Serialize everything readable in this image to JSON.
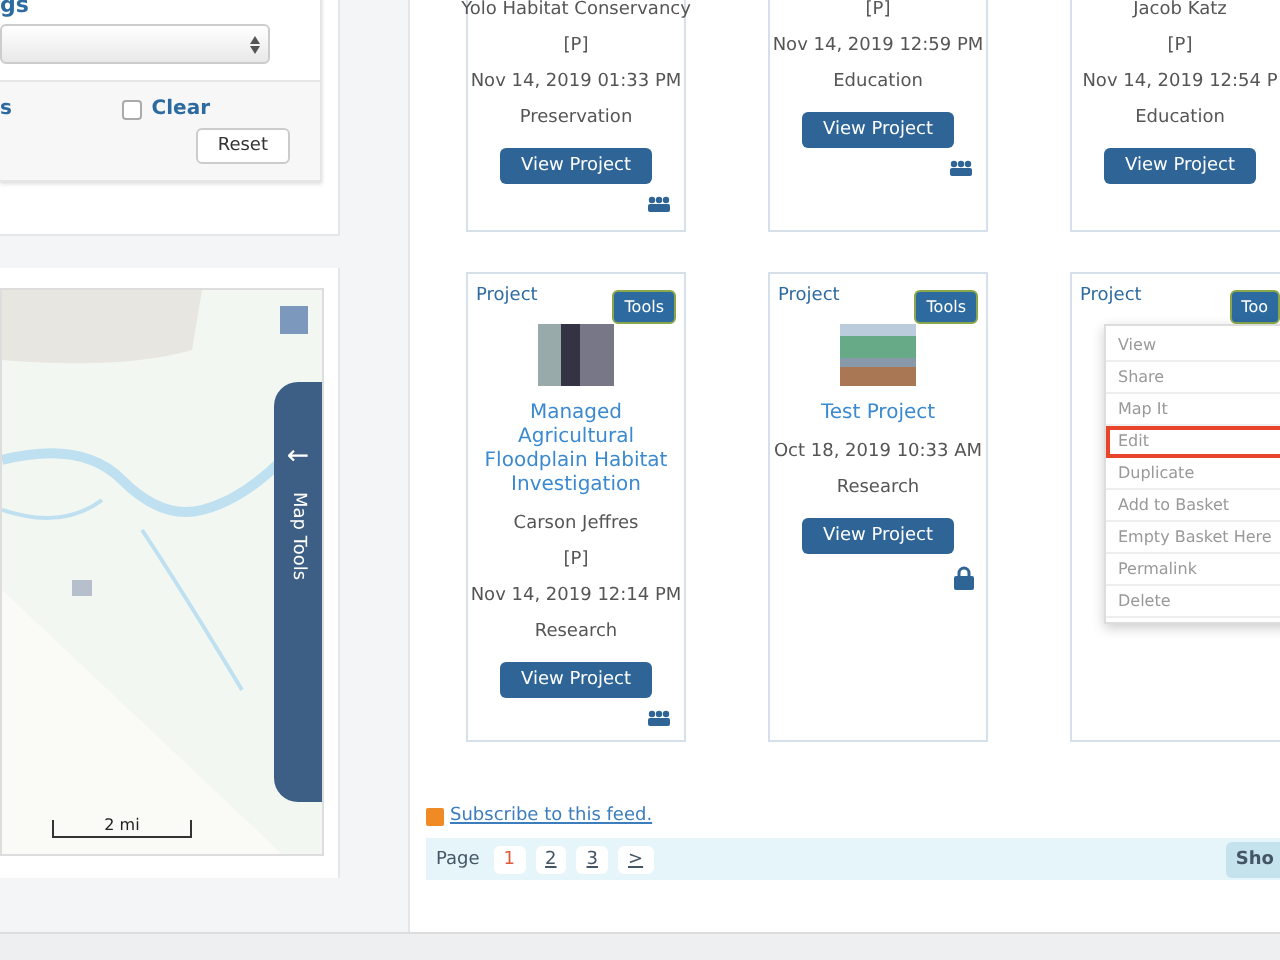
{
  "filters": {
    "field_label": "gs",
    "option_label": "s",
    "clear": {
      "label": "Clear",
      "checked": false
    },
    "reset_button": "Reset"
  },
  "map": {
    "scale": "2 mi",
    "tools_tab": "Map Tools",
    "tools_arrow": "←"
  },
  "cards_top": [
    {
      "title": "Yolo Habitat Conservancy",
      "lines": [
        "[P]",
        "Nov 14, 2019 01:33 PM",
        "Preservation"
      ],
      "button": "View Project"
    },
    {
      "title": "[P]",
      "lines": [
        "Nov 14, 2019 12:59 PM",
        "Education"
      ],
      "button": "View Project"
    },
    {
      "title": "Jacob Katz",
      "lines": [
        "[P]",
        "Nov 14, 2019 12:54 P",
        "Education"
      ],
      "button": "View Project"
    }
  ],
  "cards": [
    {
      "label": "Project",
      "tools": "Tools",
      "title": "Managed Agricultural Floodplain Habitat Investigation",
      "lines": [
        "Carson Jeffres",
        "[P]",
        "Nov 14, 2019 12:14 PM",
        "Research"
      ],
      "button": "View Project"
    },
    {
      "label": "Project",
      "tools": "Tools",
      "title": "Test Project",
      "lines": [
        "Oct 18, 2019 10:33 AM",
        "Research"
      ],
      "button": "View Project"
    },
    {
      "label": "Project",
      "tools": "Too",
      "menu": [
        {
          "label": "View",
          "selected": false
        },
        {
          "label": "Share",
          "selected": false
        },
        {
          "label": "Map It",
          "selected": false
        },
        {
          "label": "Edit",
          "selected": true
        },
        {
          "label": "Duplicate",
          "selected": false
        },
        {
          "label": "Add to Basket",
          "selected": false
        },
        {
          "label": "Empty Basket Here",
          "selected": false
        },
        {
          "label": "Permalink",
          "selected": false
        },
        {
          "label": "Delete",
          "selected": false
        }
      ]
    }
  ],
  "feed_link": "Subscribe to this feed.",
  "pagination": {
    "label": "Page",
    "pages": [
      {
        "label": "1",
        "selected": true
      },
      {
        "label": "2",
        "selected": false
      },
      {
        "label": "3",
        "selected": false
      }
    ],
    "next": ">",
    "show_button": "Sho"
  }
}
